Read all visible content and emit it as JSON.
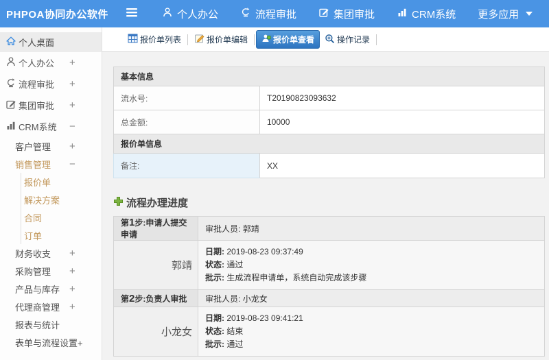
{
  "app": {
    "title": "PHPOA协同办公软件"
  },
  "colors": {
    "topbar_blue": "#4a94e4",
    "active_tab_blue": "#2d74c0",
    "submenu_orange": "#c2985c",
    "plus_green": "#7cb342",
    "remark_cell_blue": "#e7f2fa"
  },
  "topnav": {
    "items": [
      {
        "icon": "user-icon",
        "label": "个人办公"
      },
      {
        "icon": "flow-icon",
        "label": "流程审批"
      },
      {
        "icon": "edit-icon",
        "label": "集团审批"
      },
      {
        "icon": "chart-icon",
        "label": "CRM系统"
      },
      {
        "icon": "caret-down-icon",
        "label": "更多应用"
      }
    ]
  },
  "sidebar": {
    "items": [
      {
        "label": "个人桌面",
        "icon": "home-icon",
        "expander": ""
      },
      {
        "label": "个人办公",
        "icon": "user-icon",
        "expander": "+"
      },
      {
        "label": "流程审批",
        "icon": "flow-icon",
        "expander": "+"
      },
      {
        "label": "集团审批",
        "icon": "edit-icon",
        "expander": "+"
      },
      {
        "label": "CRM系统",
        "icon": "chart-icon",
        "expander": "−"
      },
      {
        "label": "客户管理",
        "expander": "+"
      },
      {
        "label": "销售管理",
        "expander": "−"
      },
      {
        "label": "报价单",
        "expander": ""
      },
      {
        "label": "解决方案",
        "expander": ""
      },
      {
        "label": "合同",
        "expander": ""
      },
      {
        "label": "订单",
        "expander": ""
      },
      {
        "label": "财务收支",
        "expander": "+"
      },
      {
        "label": "采购管理",
        "expander": "+"
      },
      {
        "label": "产品与库存",
        "expander": "+"
      },
      {
        "label": "代理商管理",
        "expander": "+"
      },
      {
        "label": "报表与统计",
        "expander": ""
      },
      {
        "label": "表单与流程设置+",
        "expander": ""
      }
    ]
  },
  "toolbar": {
    "tabs": [
      {
        "icon": "table-icon",
        "label": "报价单列表"
      },
      {
        "icon": "edit-doc-icon",
        "label": "报价单编辑"
      },
      {
        "icon": "person-view-icon",
        "label": "报价单查看"
      },
      {
        "icon": "zoom-plus-icon",
        "label": "操作记录"
      }
    ]
  },
  "info": {
    "sections": [
      {
        "header": "基本信息",
        "rows": [
          {
            "label": "流水号:",
            "value": "T20190823093632"
          },
          {
            "label": "总金额:",
            "value": "10000"
          }
        ]
      },
      {
        "header": "报价单信息",
        "rows": [
          {
            "label": "备注:",
            "value": "XX"
          }
        ]
      }
    ]
  },
  "flow": {
    "title": "流程办理进度",
    "labels": {
      "approver": "审批人员:",
      "date": "日期:",
      "status": "状态:",
      "remark": "批示:"
    },
    "steps": [
      {
        "step_prefix": "第",
        "step_num": "1",
        "step_rest": "步:申请人提交申请",
        "approver": "郭靖",
        "name": "郭靖",
        "date": "2019-08-23 09:37:49",
        "status": "通过",
        "remark": "生成流程申请单，系统自动完成该步骤"
      },
      {
        "step_prefix": "第",
        "step_num": "2",
        "step_rest": "步:负责人审批",
        "approver": "小龙女",
        "name": "小龙女",
        "date": "2019-08-23 09:41:21",
        "status": "结束",
        "remark": "通过"
      }
    ]
  }
}
